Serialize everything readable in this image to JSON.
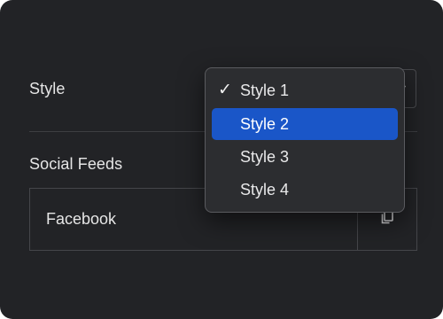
{
  "settings": {
    "style_label": "Style",
    "social_feeds_label": "Social Feeds"
  },
  "dropdown": {
    "options": [
      {
        "label": "Style 1",
        "checked": true
      },
      {
        "label": "Style 2",
        "highlighted": true
      },
      {
        "label": "Style 3"
      },
      {
        "label": "Style 4"
      }
    ],
    "check_glyph": "✓"
  },
  "social_feeds": {
    "items": [
      {
        "label": "Facebook"
      }
    ]
  },
  "icons": {
    "copy": "copy-icon",
    "caret": "chevron-down-icon"
  },
  "colors": {
    "background": "#222326",
    "menu_background": "#2c2d30",
    "highlight": "#1a56c8",
    "text": "#e6e6e6",
    "border": "#45464a"
  }
}
